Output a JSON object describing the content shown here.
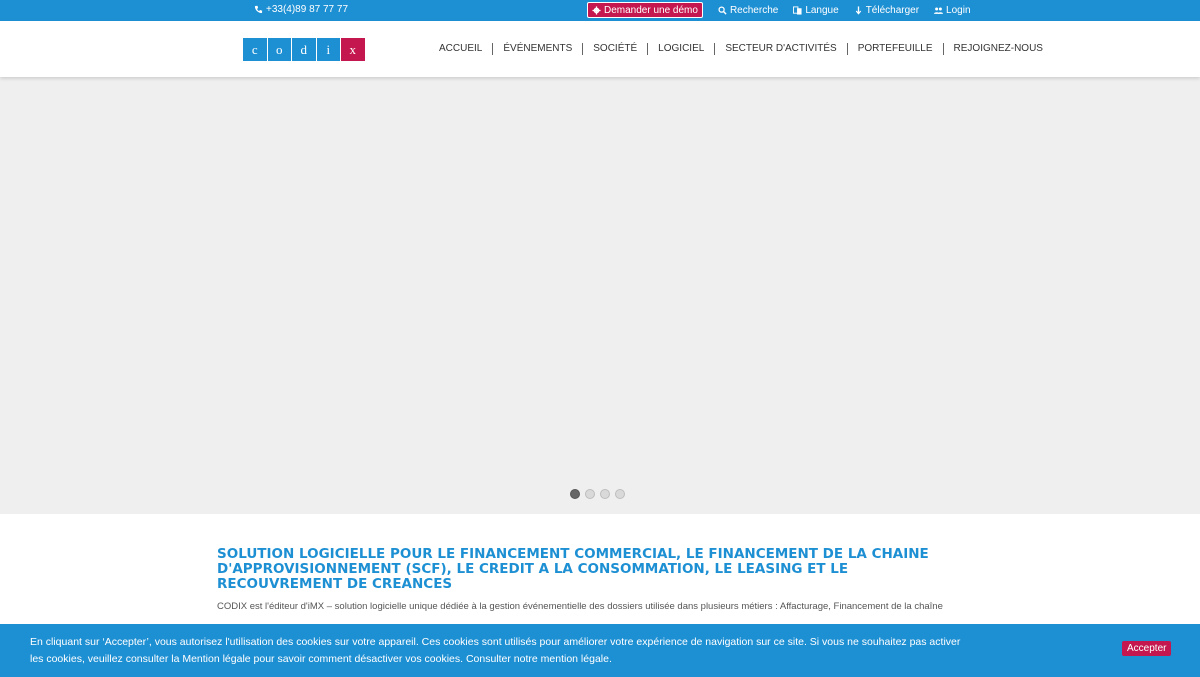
{
  "topbar": {
    "phone": "+33(4)89 87 77 77",
    "demo_label": "Demander une démo",
    "search_label": "Recherche",
    "language_label": "Langue",
    "download_label": "Télécharger",
    "login_label": "Login"
  },
  "logo": {
    "letters": [
      "c",
      "o",
      "d",
      "i",
      "x"
    ]
  },
  "nav": {
    "items": [
      {
        "label": "ACCUEIL"
      },
      {
        "label": "ÉVÉNEMENTS"
      },
      {
        "label": "SOCIÉTÉ"
      },
      {
        "label": "LOGICIEL"
      },
      {
        "label": "SECTEUR D'ACTIVITÉS"
      },
      {
        "label": "PORTEFEUILLE"
      },
      {
        "label": "REJOIGNEZ-NOUS"
      }
    ]
  },
  "slider": {
    "slide_count": 4,
    "active_index": 0
  },
  "content": {
    "title": "SOLUTION LOGICIELLE POUR LE FINANCEMENT COMMERCIAL, LE FINANCEMENT DE LA CHAINE D'APPROVISIONNEMENT (SCF), LE CREDIT A LA CONSOMMATION, LE LEASING ET LE RECOUVREMENT DE CREANCES",
    "paragraph": "CODIX est l'éditeur d'iMX – solution logicielle unique dédiée à la gestion événementielle des dossiers utilisée dans plusieurs métiers : Affacturage, Financement de la chaîne"
  },
  "cookie": {
    "message": "En cliquant sur ‘Accepter’, vous autorisez l'utilisation des cookies sur votre appareil. Ces cookies sont utilisés pour améliorer votre expérience de navigation sur ce site. Si vous ne souhaitez pas activer les cookies, veuillez consulter la Mention légale pour savoir comment désactiver vos cookies. Consulter notre mention légale.",
    "accept_label": "Accepter"
  },
  "colors": {
    "brand_blue": "#1d8fd3",
    "brand_red": "#c4174f",
    "slider_bg": "#efefef"
  },
  "icons": [
    "phone-icon",
    "gear-icon",
    "search-icon",
    "language-icon",
    "download-icon",
    "users-icon"
  ]
}
